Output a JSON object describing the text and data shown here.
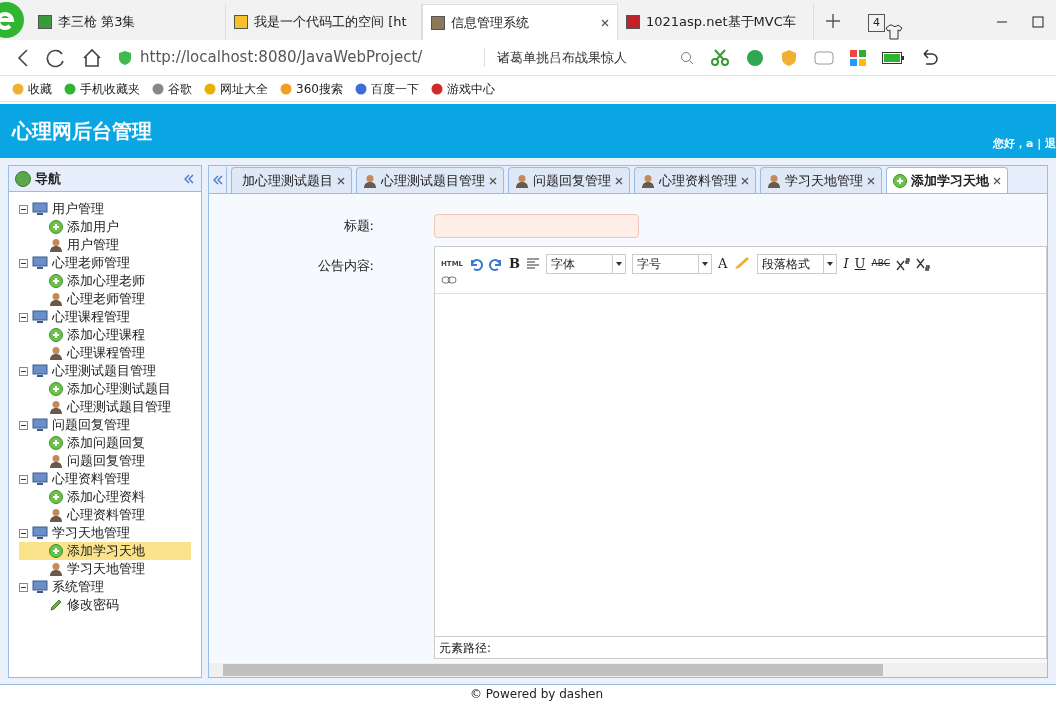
{
  "browser": {
    "tabs": [
      {
        "title": "李三枪 第3集",
        "selected": false
      },
      {
        "title": "我是一个代码工的空间 [ht",
        "selected": false
      },
      {
        "title": "信息管理系统",
        "selected": true
      },
      {
        "title": "1021asp.net基于MVC车",
        "selected": false
      }
    ],
    "tab_count": "4",
    "address": "http://localhost:8080/JavaWebProject/",
    "search_hint": "诸葛单挑吕布战果惊人",
    "bookmarks": [
      "收藏",
      "手机收藏夹",
      "谷歌",
      "网址大全",
      "360搜索",
      "百度一下",
      "游戏中心"
    ]
  },
  "app": {
    "title": "心理网后台管理",
    "user_links": "您好，a | 退",
    "nav": {
      "title": "导航",
      "tree": [
        {
          "label": "用户管理",
          "expanded": true,
          "children": [
            {
              "label": "添加用户",
              "kind": "add",
              "selected": false
            },
            {
              "label": "用户管理",
              "kind": "manage",
              "selected": false
            }
          ]
        },
        {
          "label": "心理老师管理",
          "expanded": true,
          "children": [
            {
              "label": "添加心理老师",
              "kind": "add",
              "selected": false
            },
            {
              "label": "心理老师管理",
              "kind": "manage",
              "selected": false
            }
          ]
        },
        {
          "label": "心理课程管理",
          "expanded": true,
          "children": [
            {
              "label": "添加心理课程",
              "kind": "add",
              "selected": false
            },
            {
              "label": "心理课程管理",
              "kind": "manage",
              "selected": false
            }
          ]
        },
        {
          "label": "心理测试题目管理",
          "expanded": true,
          "children": [
            {
              "label": "添加心理测试题目",
              "kind": "add",
              "selected": false
            },
            {
              "label": "心理测试题目管理",
              "kind": "manage",
              "selected": false
            }
          ]
        },
        {
          "label": "问题回复管理",
          "expanded": true,
          "children": [
            {
              "label": "添加问题回复",
              "kind": "add",
              "selected": false
            },
            {
              "label": "问题回复管理",
              "kind": "manage",
              "selected": false
            }
          ]
        },
        {
          "label": "心理资料管理",
          "expanded": true,
          "children": [
            {
              "label": "添加心理资料",
              "kind": "add",
              "selected": false
            },
            {
              "label": "心理资料管理",
              "kind": "manage",
              "selected": false
            }
          ]
        },
        {
          "label": "学习天地管理",
          "expanded": true,
          "children": [
            {
              "label": "添加学习天地",
              "kind": "add",
              "selected": true
            },
            {
              "label": "学习天地管理",
              "kind": "manage",
              "selected": false
            }
          ]
        },
        {
          "label": "系统管理",
          "expanded": true,
          "children": [
            {
              "label": "修改密码",
              "kind": "edit",
              "selected": false
            }
          ]
        }
      ]
    },
    "tabs": [
      {
        "label": "加心理测试题目",
        "selected": false
      },
      {
        "label": "心理测试题目管理",
        "kind": "manage",
        "selected": false
      },
      {
        "label": "问题回复管理",
        "kind": "manage",
        "selected": false
      },
      {
        "label": "心理资料管理",
        "kind": "manage",
        "selected": false
      },
      {
        "label": "学习天地管理",
        "kind": "manage",
        "selected": false
      },
      {
        "label": "添加学习天地",
        "kind": "add",
        "selected": true
      }
    ],
    "form": {
      "title_label": "标题:",
      "content_label": "公告内容:",
      "editor": {
        "html_button": "HTML",
        "bold_button": "B",
        "font_color_button": "A",
        "italic_button": "I",
        "underline_button": "U",
        "strike_button": "ABC",
        "font_select": "字体",
        "size_select": "字号",
        "format_select": "段落格式",
        "element_path": "元素路径:"
      }
    },
    "footer": "© Powered by dashen"
  }
}
